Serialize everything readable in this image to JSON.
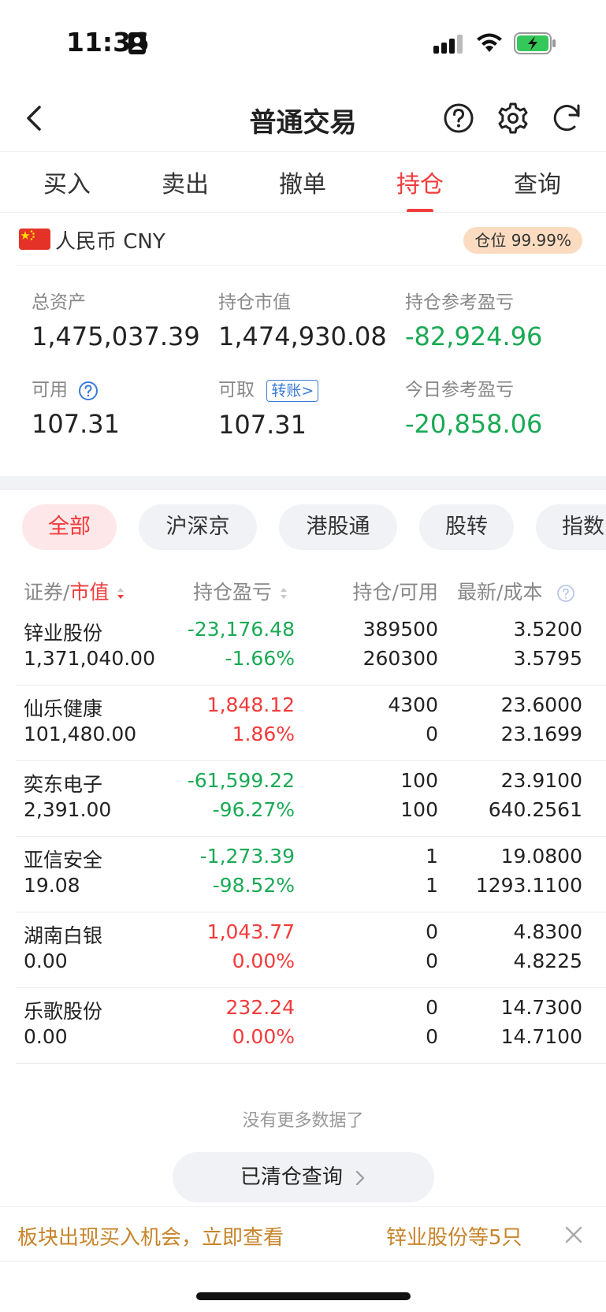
{
  "status_bar": {
    "time": "11:36"
  },
  "nav": {
    "title": "普通交易",
    "icons": [
      "back-icon",
      "help-icon",
      "settings-icon",
      "refresh-icon"
    ]
  },
  "tabs": [
    {
      "label": "买入"
    },
    {
      "label": "卖出"
    },
    {
      "label": "撤单"
    },
    {
      "label": "持仓",
      "active": true
    },
    {
      "label": "查询"
    }
  ],
  "currency": {
    "label": "人民币 CNY",
    "position_badge": "仓位 99.99%"
  },
  "summary": {
    "total_assets_label": "总资产",
    "total_assets": "1,475,037.39",
    "market_value_label": "持仓市值",
    "market_value": "1,474,930.08",
    "position_pl_label": "持仓参考盈亏",
    "position_pl": "-82,924.96",
    "available_label": "可用",
    "available": "107.31",
    "withdrawable_label": "可取",
    "transfer_label": "转账>",
    "withdrawable": "107.31",
    "today_pl_label": "今日参考盈亏",
    "today_pl": "-20,858.06"
  },
  "filters": [
    {
      "label": "全部",
      "active": true
    },
    {
      "label": "沪深京"
    },
    {
      "label": "港股通"
    },
    {
      "label": "股转"
    },
    {
      "label": "指数"
    }
  ],
  "table": {
    "headers": {
      "security": "证券",
      "sep": "/",
      "market_value": "市值",
      "pl": "持仓盈亏",
      "qty": "持仓",
      "available": "可用",
      "latest": "最新",
      "cost": "成本"
    },
    "rows": [
      {
        "name": "锌业股份",
        "market_value": "1,371,040.00",
        "pl": "-23,176.48",
        "pl_pct": "-1.66%",
        "pl_sign": "neg",
        "qty": "389500",
        "available": "260300",
        "latest": "3.5200",
        "cost": "3.5795"
      },
      {
        "name": "仙乐健康",
        "market_value": "101,480.00",
        "pl": "1,848.12",
        "pl_pct": "1.86%",
        "pl_sign": "pos",
        "qty": "4300",
        "available": "0",
        "latest": "23.6000",
        "cost": "23.1699"
      },
      {
        "name": "奕东电子",
        "market_value": "2,391.00",
        "pl": "-61,599.22",
        "pl_pct": "-96.27%",
        "pl_sign": "neg",
        "qty": "100",
        "available": "100",
        "latest": "23.9100",
        "cost": "640.2561"
      },
      {
        "name": "亚信安全",
        "market_value": "19.08",
        "pl": "-1,273.39",
        "pl_pct": "-98.52%",
        "pl_sign": "neg",
        "qty": "1",
        "available": "1",
        "latest": "19.0800",
        "cost": "1293.1100"
      },
      {
        "name": "湖南白银",
        "market_value": "0.00",
        "pl": "1,043.77",
        "pl_pct": "0.00%",
        "pl_sign": "pos",
        "qty": "0",
        "available": "0",
        "latest": "4.8300",
        "cost": "4.8225"
      },
      {
        "name": "乐歌股份",
        "market_value": "0.00",
        "pl": "232.24",
        "pl_pct": "0.00%",
        "pl_sign": "pos",
        "qty": "0",
        "available": "0",
        "latest": "14.7300",
        "cost": "14.7100"
      }
    ]
  },
  "footer": {
    "no_more": "没有更多数据了",
    "cleared_button": "已清仓查询"
  },
  "banner": {
    "text": "板块出现买入机会，立即查看",
    "text2": "锌业股份等5只"
  },
  "colors": {
    "accent_red": "#f23b3b",
    "gain_red": "#f23b3b",
    "loss_green": "#1aaa55",
    "badge_bg": "#fbdcc0",
    "banner_text": "#c8842a",
    "transfer_blue": "#3a7bd5"
  }
}
